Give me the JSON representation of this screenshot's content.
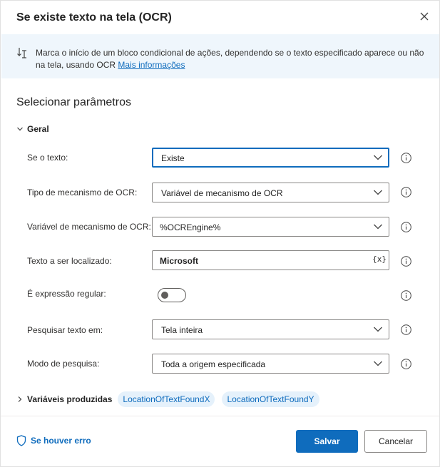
{
  "dialog": {
    "title": "Se existe texto na tela (OCR)",
    "close_icon": "close-icon"
  },
  "info": {
    "icon": "block-start-icon",
    "text": "Marca o início de um bloco condicional de ações, dependendo se o texto especificado aparece ou não na tela, usando OCR ",
    "link": "Mais informações"
  },
  "section_title": "Selecionar parâmetros",
  "group": {
    "label": "Geral",
    "expanded": true
  },
  "fields": {
    "if_text": {
      "label": "Se o texto:",
      "value": "Existe",
      "focused": true
    },
    "ocr_engine_type": {
      "label": "Tipo de mecanismo de OCR:",
      "value": "Variável de mecanismo de OCR"
    },
    "ocr_engine_var": {
      "label": "Variável de mecanismo de OCR:",
      "value": "%OCREngine%"
    },
    "text_to_find": {
      "label": "Texto a ser localizado:",
      "value": "Microsoft",
      "var_button": "{x}"
    },
    "is_regex": {
      "label": "É expressão regular:",
      "enabled": false
    },
    "search_in": {
      "label": "Pesquisar texto em:",
      "value": "Tela inteira"
    },
    "search_mode": {
      "label": "Modo de pesquisa:",
      "value": "Toda a origem especificada"
    }
  },
  "produced_vars": {
    "label": "Variáveis produzidas",
    "items": [
      "LocationOfTextFoundX",
      "LocationOfTextFoundY"
    ]
  },
  "footer": {
    "error_link": "Se houver erro",
    "save": "Salvar",
    "cancel": "Cancelar"
  },
  "colors": {
    "accent": "#0f6cbd",
    "info_background": "#eff6fc",
    "pill_background": "#e5f1fb"
  }
}
